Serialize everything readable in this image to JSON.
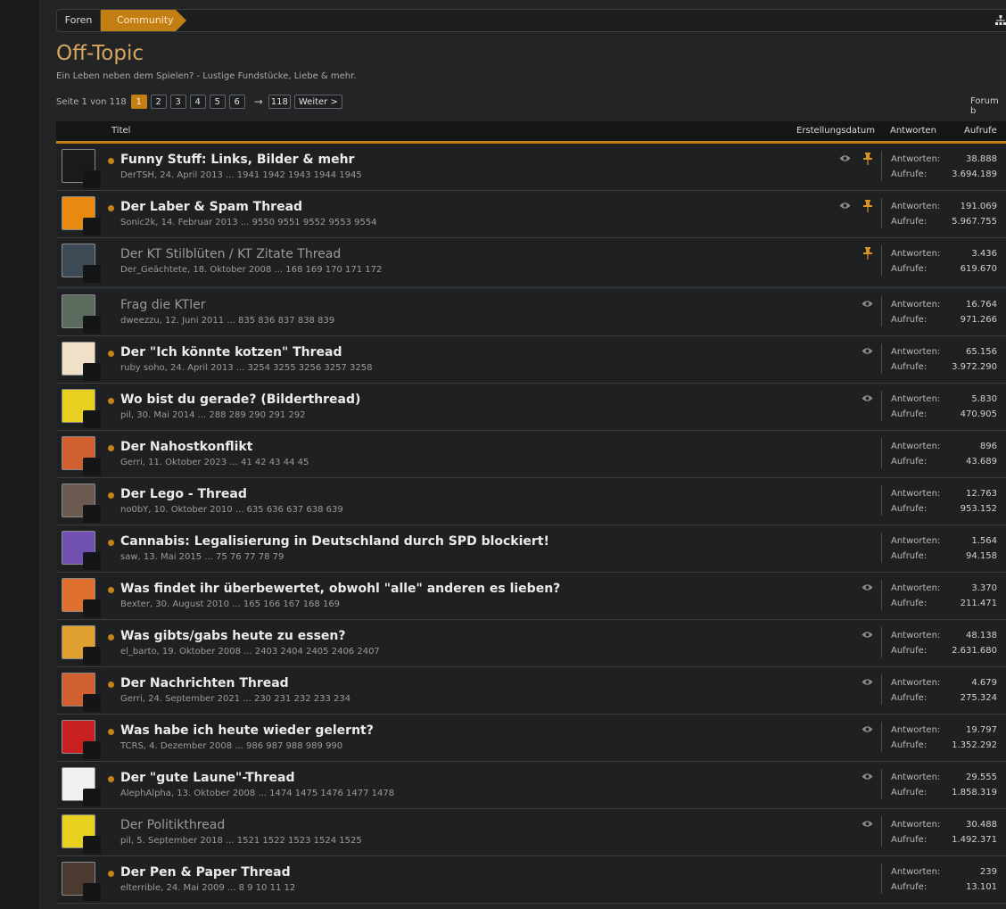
{
  "breadcrumb": {
    "foren": "Foren",
    "community": "Community"
  },
  "forum": {
    "title": "Off-Topic",
    "description": "Ein Leben neben dem Spielen? - Lustige Fundstücke, Liebe & mehr."
  },
  "pagination": {
    "info": "Seite 1 von 118",
    "pages": [
      "1",
      "2",
      "3",
      "4",
      "5",
      "6"
    ],
    "arrow": "→",
    "last": "118",
    "next": "Weiter >"
  },
  "forum_b": "Forum b",
  "table_header": {
    "title": "Titel",
    "created": "Erstellungsdatum",
    "replies": "Antworten",
    "views": "Aufrufe"
  },
  "labels": {
    "replies": "Antworten:",
    "views": "Aufrufe:"
  },
  "colors": {
    "accent": "#c47f14",
    "title": "#d6a75d"
  },
  "threads": [
    {
      "title": "Funny Stuff: Links, Bilder & mehr",
      "meta": "DerTSH, 24. April 2013 ... 1941 1942 1943 1944 1945",
      "replies": "38.888",
      "views": "3.694.189",
      "unread": true,
      "watched": true,
      "sticky": true,
      "avatar": "#1a1a1a"
    },
    {
      "title": "Der Laber & Spam Thread",
      "meta": "Sonic2k, 14. Februar 2013 ... 9550 9551 9552 9553 9554",
      "replies": "191.069",
      "views": "5.967.755",
      "unread": true,
      "watched": true,
      "sticky": true,
      "avatar": "#e88a10"
    },
    {
      "title": "Der KT Stilblüten / KT Zitate Thread",
      "meta": "Der_Geächtete, 18. Oktober 2008 ... 168 169 170 171 172",
      "replies": "3.436",
      "views": "619.670",
      "unread": false,
      "watched": false,
      "sticky": true,
      "avatar": "#3d4a55"
    },
    {
      "title": "Frag die KTler",
      "meta": "dweezzu, 12. Juni 2011 ... 835 836 837 838 839",
      "replies": "16.764",
      "views": "971.266",
      "unread": false,
      "watched": true,
      "sticky": false,
      "avatar": "#5b6b5e"
    },
    {
      "title": "Der \"Ich könnte kotzen\" Thread",
      "meta": "ruby soho, 24. April 2013 ... 3254 3255 3256 3257 3258",
      "replies": "65.156",
      "views": "3.972.290",
      "unread": true,
      "watched": true,
      "sticky": false,
      "avatar": "#f0e0c8"
    },
    {
      "title": "Wo bist du gerade? (Bilderthread)",
      "meta": "pil, 30. Mai 2014 ... 288 289 290 291 292",
      "replies": "5.830",
      "views": "470.905",
      "unread": true,
      "watched": true,
      "sticky": false,
      "avatar": "#e8d020"
    },
    {
      "title": "Der Nahostkonflikt",
      "meta": "Gerri, 11. Oktober 2023 ... 41 42 43 44 45",
      "replies": "896",
      "views": "43.689",
      "unread": true,
      "watched": false,
      "sticky": false,
      "avatar": "#d06030"
    },
    {
      "title": "Der Lego - Thread",
      "meta": "no0bY, 10. Oktober 2010 ... 635 636 637 638 639",
      "replies": "12.763",
      "views": "953.152",
      "unread": true,
      "watched": false,
      "sticky": false,
      "avatar": "#6a5a50"
    },
    {
      "title": "Cannabis: Legalisierung in Deutschland durch SPD blockiert!",
      "meta": "saw, 13. Mai 2015 ... 75 76 77 78 79",
      "replies": "1.564",
      "views": "94.158",
      "unread": true,
      "watched": false,
      "sticky": false,
      "avatar": "#7050b0"
    },
    {
      "title": "Was findet ihr überbewertet, obwohl \"alle\" anderen es lieben?",
      "meta": "Bexter, 30. August 2010 ... 165 166 167 168 169",
      "replies": "3.370",
      "views": "211.471",
      "unread": true,
      "watched": true,
      "sticky": false,
      "avatar": "#e07030"
    },
    {
      "title": "Was gibts/gabs heute zu essen?",
      "meta": "el_barto, 19. Oktober 2008 ... 2403 2404 2405 2406 2407",
      "replies": "48.138",
      "views": "2.631.680",
      "unread": true,
      "watched": true,
      "sticky": false,
      "avatar": "#e0a030"
    },
    {
      "title": "Der Nachrichten Thread",
      "meta": "Gerri, 24. September 2021 ... 230 231 232 233 234",
      "replies": "4.679",
      "views": "275.324",
      "unread": true,
      "watched": true,
      "sticky": false,
      "avatar": "#d06030"
    },
    {
      "title": "Was habe ich heute wieder gelernt?",
      "meta": "TCRS, 4. Dezember 2008 ... 986 987 988 989 990",
      "replies": "19.797",
      "views": "1.352.292",
      "unread": true,
      "watched": true,
      "sticky": false,
      "avatar": "#c82020"
    },
    {
      "title": "Der \"gute Laune\"-Thread",
      "meta": "AlephAlpha, 13. Oktober 2008 ... 1474 1475 1476 1477 1478",
      "replies": "29.555",
      "views": "1.858.319",
      "unread": true,
      "watched": true,
      "sticky": false,
      "avatar": "#f0f0f0"
    },
    {
      "title": "Der Politikthread",
      "meta": "pil, 5. September 2018 ... 1521 1522 1523 1524 1525",
      "replies": "30.488",
      "views": "1.492.371",
      "unread": false,
      "watched": true,
      "sticky": false,
      "avatar": "#e8d020"
    },
    {
      "title": "Der Pen & Paper Thread",
      "meta": "elterrible, 24. Mai 2009 ... 8 9 10 11 12",
      "replies": "239",
      "views": "13.101",
      "unread": true,
      "watched": false,
      "sticky": false,
      "avatar": "#4a3a30"
    }
  ]
}
